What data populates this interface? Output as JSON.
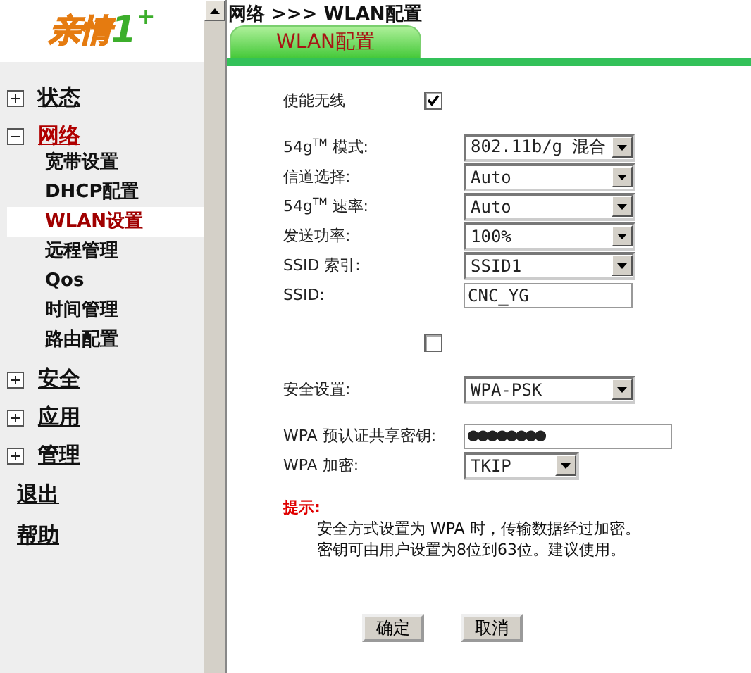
{
  "logo": {
    "parts": [
      {
        "text": "亲情",
        "kind": "word"
      },
      {
        "text": "1",
        "kind": "digit"
      },
      {
        "text": "+",
        "kind": "plus"
      }
    ]
  },
  "sidebar": {
    "items": [
      {
        "label": "状态",
        "expanded": false
      },
      {
        "label": "网络",
        "expanded": true,
        "children": [
          {
            "label": "宽带设置",
            "selected": false
          },
          {
            "label": "DHCP配置",
            "selected": false
          },
          {
            "label": "WLAN设置",
            "selected": true
          },
          {
            "label": "远程管理",
            "selected": false
          },
          {
            "label": "Qos",
            "selected": false
          },
          {
            "label": "时间管理",
            "selected": false
          },
          {
            "label": "路由配置",
            "selected": false
          }
        ]
      },
      {
        "label": "安全",
        "expanded": false
      },
      {
        "label": "应用",
        "expanded": false
      },
      {
        "label": "管理",
        "expanded": false
      }
    ],
    "links": [
      "退出",
      "帮助"
    ]
  },
  "breadcrumb": "网络 >>> WLAN配置",
  "tabs": [
    {
      "label": "WLAN配置",
      "selected": true
    }
  ],
  "form": {
    "rows": [
      {
        "kind": "checkbox",
        "label": "使能无线",
        "checked": true
      },
      {
        "kind": "gap"
      },
      {
        "kind": "select",
        "label": "54g$^{TM}$ 模式:",
        "value": "802.11b/g 混合"
      },
      {
        "kind": "select",
        "label": "信道选择:",
        "value": "Auto"
      },
      {
        "kind": "select",
        "label": "54g$^{TM}$ 速率:",
        "value": "Auto"
      },
      {
        "kind": "select",
        "label": "发送功率:",
        "value": "100%"
      },
      {
        "kind": "select",
        "label": "SSID 索引:",
        "value": "SSID1"
      },
      {
        "kind": "text",
        "label": "SSID:",
        "value": "CNC_YG"
      },
      {
        "kind": "blank"
      },
      {
        "kind": "checkbox",
        "checked": false
      },
      {
        "kind": "gap"
      },
      {
        "kind": "select",
        "label": "安全设置:",
        "value": "WPA-PSK"
      },
      {
        "kind": "gap"
      },
      {
        "kind": "password",
        "label": "WPA 预认证共享密钥:",
        "value": "●●●●●●●●"
      },
      {
        "kind": "select-small",
        "label": "WPA 加密:",
        "value": "TKIP"
      }
    ]
  },
  "hint": {
    "title": "提示:",
    "lines": [
      "安全方式设置为 WPA 时，传输数据经过加密。",
      "密钥可由用户设置为8位到63位。建议使用。"
    ]
  },
  "buttons": [
    "确定",
    "取消"
  ]
}
